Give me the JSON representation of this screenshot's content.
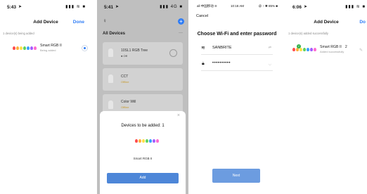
{
  "screen1": {
    "time": "5:43",
    "status_icons": "▮▮▮ ≋ ■",
    "title": "Add Device",
    "done": "Done",
    "caption": "1 device(s) being added",
    "device": {
      "name": "Smart RGB II",
      "status": "Being added"
    }
  },
  "screen2": {
    "time": "5:41",
    "status_icons": "▮▮▮ 4G ■",
    "header": "All Devices",
    "more": "···",
    "items": [
      {
        "name": "10SL1 RGB Tree",
        "status": "● Off"
      },
      {
        "name": "CCT",
        "status": "Offline"
      },
      {
        "name": "Color Will",
        "status": "Offline"
      }
    ],
    "sheet": {
      "close": "×",
      "title": "Devices to be added: 1",
      "device_name": "Smart RGB II",
      "add_button": "Add"
    }
  },
  "screen3": {
    "carrier": "all 中国移动 ≋",
    "time": "10:18 AM",
    "battery": "@ ↑ ✱ 85% ■",
    "cancel": "Cancel",
    "heading": "Choose Wi-Fi and enter password",
    "ssid": "SANBRITE",
    "password": "••••••••••",
    "next": "Next"
  },
  "screen4": {
    "time": "6:06",
    "status_icons": "▮▮▮ ≋ ■",
    "title": "Add Device",
    "done": "Do",
    "caption": "1 device(s) added successfully",
    "device": {
      "name": "Smart RGB II",
      "status": "Added successfully",
      "count": "2"
    }
  },
  "colors": {
    "accent": "#2f7df6",
    "button_blue": "#4d86d8",
    "success_green": "#33b24a"
  },
  "bulb_colors": [
    "#ff4d4d",
    "#ffb13b",
    "#ffe14a",
    "#5fd35f",
    "#3aa0ff",
    "#a35dff",
    "#ff6bd0"
  ]
}
